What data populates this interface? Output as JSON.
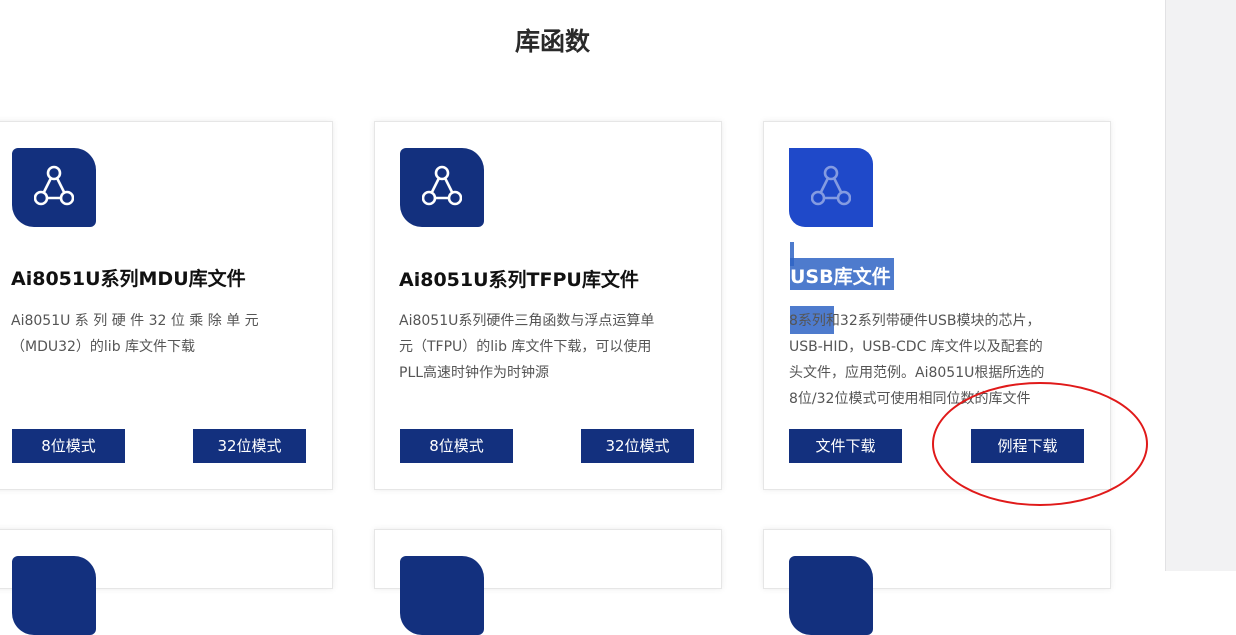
{
  "page": {
    "title": "库函数"
  },
  "cards": [
    {
      "icon": "network-share-icon",
      "title": "Ai8051U系列MDU库文件",
      "desc_lines": [
        "Ai8051U 系 列 硬 件 32 位 乘 除 单 元",
        "（MDU32）的lib 库文件下载"
      ],
      "buttons": [
        "8位模式",
        "32位模式"
      ]
    },
    {
      "icon": "network-share-icon",
      "title": "Ai8051U系列TFPU库文件",
      "desc_lines": [
        "Ai8051U系列硬件三角函数与浮点运算单",
        "元（TFPU）的lib 库文件下载，可以使用",
        "PLL高速时钟作为时钟源"
      ],
      "buttons": [
        "8位模式",
        "32位模式"
      ]
    },
    {
      "icon": "network-share-icon",
      "title": "USB库文件",
      "desc_lines": [
        "8系列和32系列带硬件USB模块的芯片，",
        "USB-HID，USB-CDC 库文件以及配套的",
        "头文件，应用范例。Ai8051U根据所选的",
        "8位/32位模式可使用相同位数的库文件"
      ],
      "buttons": [
        "文件下载",
        "例程下载"
      ]
    }
  ],
  "colors": {
    "brand_blue": "#13307e",
    "selection_blue": "#2f64c4",
    "annotation_red": "#e01a1a"
  }
}
